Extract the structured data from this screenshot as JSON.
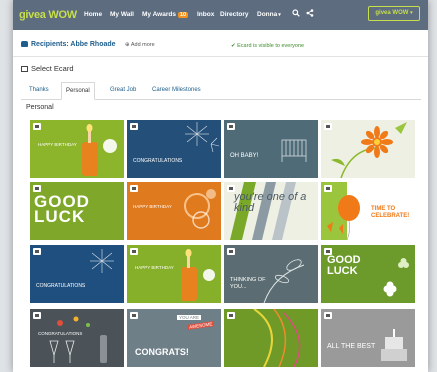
{
  "nav": {
    "logo": "givea WOW",
    "items": [
      "Home",
      "My Wall",
      "My Awards",
      "Inbox",
      "Directory",
      "Donna"
    ],
    "awards_badge": "10",
    "brand_box": "givea WOW"
  },
  "recipients": {
    "label": "Recipients: Abbe Rhoade",
    "add_more": "Add more",
    "visibility": "Ecard is visible to everyone"
  },
  "select_title": "Select Ecard",
  "tabs": [
    "Thanks",
    "Personal",
    "Great Job",
    "Career Milestones"
  ],
  "active_tab": "Personal",
  "section_title": "Personal",
  "cards": [
    {
      "name": "happy-birthday-candle",
      "text": "HAPPY BIRTHDAY",
      "bg": "#8db52b"
    },
    {
      "name": "congratulations-fireworks",
      "text": "CONGRATULATIONS",
      "bg": "#244f78"
    },
    {
      "name": "oh-baby",
      "text": "OH BABY!",
      "bg": "#4f6b78"
    },
    {
      "name": "orange-flowers",
      "text": "",
      "bg": "#eef0e3"
    },
    {
      "name": "good-luck-green",
      "text": "GOOD LUCK",
      "bg": "#7fa82b"
    },
    {
      "name": "happy-birthday-orange",
      "text": "HAPPY BIRTHDAY",
      "bg": "#e07a1e"
    },
    {
      "name": "youre-one-of-a-kind",
      "text": "you're one of a kind",
      "bg": "#eef0e3"
    },
    {
      "name": "time-to-celebrate",
      "text": "TIME TO CELEBRATE!",
      "bg": "#ffffff"
    },
    {
      "name": "congratulations-blue",
      "text": "CONGRATULATIONS",
      "bg": "#1f4f7e"
    },
    {
      "name": "happy-birthday-candle-2",
      "text": "HAPPY BIRTHDAY",
      "bg": "#87b02a"
    },
    {
      "name": "thinking-of-you",
      "text": "THINKING OF YOU...",
      "bg": "#5b6d72"
    },
    {
      "name": "good-luck-clover",
      "text": "GOOD LUCK",
      "bg": "#6c9a2b"
    },
    {
      "name": "congratulations-champagne",
      "text": "CONGRATULATIONS",
      "bg": "#4b5358"
    },
    {
      "name": "you-are-congrats",
      "text": "CONGRATS!",
      "bg": "#6e7f88"
    },
    {
      "name": "green-ribbons",
      "text": "",
      "bg": "#6f9a27"
    },
    {
      "name": "all-the-best",
      "text": "ALL THE BEST",
      "bg": "#9a9a9a"
    }
  ]
}
